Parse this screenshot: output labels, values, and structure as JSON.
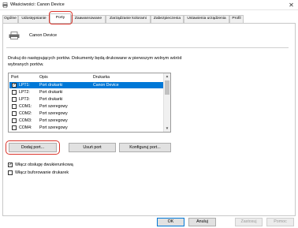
{
  "window": {
    "title": "Właściwości: Canon Device"
  },
  "tabs": [
    {
      "label": "Ogólne"
    },
    {
      "label": "Udostępnianie"
    },
    {
      "label": "Porty"
    },
    {
      "label": "Zaawansowane"
    },
    {
      "label": "Zarządzanie kolorami"
    },
    {
      "label": "Zabezpieczenia"
    },
    {
      "label": "Ustawienia urządzenia"
    },
    {
      "label": "Profil"
    }
  ],
  "active_tab": "Porty",
  "device": {
    "name": "Canon Device"
  },
  "description": "Drukuj do następujących portów. Dokumenty będą drukowane w pierwszym wolnym wśród wybranych portów.",
  "port_list": {
    "headers": {
      "port": "Port",
      "opis": "Opis",
      "drukarka": "Drukarka"
    },
    "rows": [
      {
        "checked": true,
        "port": "LPT1:",
        "opis": "Port drukarki",
        "drukarka": "Canon Device",
        "selected": true
      },
      {
        "checked": false,
        "port": "LPT2:",
        "opis": "Port drukarki",
        "drukarka": "",
        "selected": false
      },
      {
        "checked": false,
        "port": "LPT3:",
        "opis": "Port drukarki",
        "drukarka": "",
        "selected": false
      },
      {
        "checked": false,
        "port": "COM1:",
        "opis": "Port szeregowy",
        "drukarka": "",
        "selected": false
      },
      {
        "checked": false,
        "port": "COM2:",
        "opis": "Port szeregowy",
        "drukarka": "",
        "selected": false
      },
      {
        "checked": false,
        "port": "COM3:",
        "opis": "Port szeregowy",
        "drukarka": "",
        "selected": false
      },
      {
        "checked": false,
        "port": "COM4:",
        "opis": "Port szeregowy",
        "drukarka": "",
        "selected": false
      }
    ]
  },
  "port_buttons": {
    "add": "Dodaj port...",
    "delete": "Usuń port",
    "configure": "Konfiguruj port..."
  },
  "options": {
    "bidirectional": {
      "label": "Włącz obsługę dwukierunkową",
      "checked": true
    },
    "pooling": {
      "label": "Włącz buforowanie drukarek",
      "checked": false
    }
  },
  "footer": {
    "ok": "OK",
    "cancel": "Anuluj",
    "apply": "Zastosuj",
    "help": "Pomoc"
  },
  "colors": {
    "selection": "#0078d7",
    "highlight_outline": "#d9342b"
  }
}
